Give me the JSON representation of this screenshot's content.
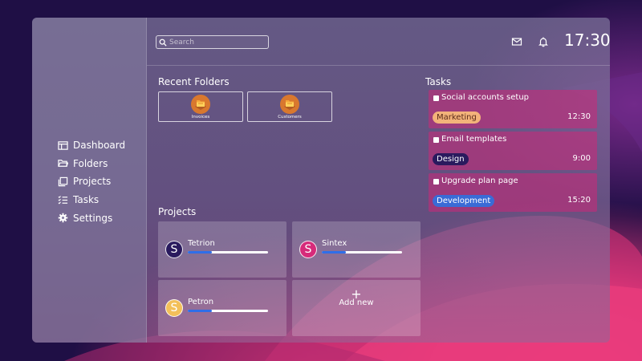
{
  "colors": {
    "accent_blue": "#2f6ee8",
    "tag_marketing": "#f3b37a",
    "tag_design": "#2a1a5e",
    "tag_development": "#3a6bd6",
    "avatar_tetrion": "#2a1a5e",
    "avatar_sintex": "#d62b7a",
    "avatar_petron": "#f3c05a"
  },
  "search": {
    "placeholder": "Search",
    "icon": "search-icon"
  },
  "header": {
    "clock": "17:30",
    "icons": [
      "mail-icon",
      "bell-icon"
    ]
  },
  "sidebar": {
    "items": [
      {
        "label": "Dashboard",
        "icon": "dashboard-icon"
      },
      {
        "label": "Folders",
        "icon": "folder-icon"
      },
      {
        "label": "Projects",
        "icon": "projects-icon"
      },
      {
        "label": "Tasks",
        "icon": "tasks-icon"
      },
      {
        "label": "Settings",
        "icon": "gear-icon"
      }
    ]
  },
  "recent_folders": {
    "title": "Recent Folders",
    "items": [
      {
        "label": "Invoices",
        "icon": "folder-icon"
      },
      {
        "label": "Customers",
        "icon": "folder-icon"
      }
    ]
  },
  "projects": {
    "title": "Projects",
    "items": [
      {
        "initial": "S",
        "name": "Tetrion",
        "progress": 0.3
      },
      {
        "initial": "S",
        "name": "Sintex",
        "progress": 0.3
      },
      {
        "initial": "S",
        "name": "Petron",
        "progress": 0.3
      }
    ],
    "add_new": {
      "plus": "+",
      "label": "Add new"
    }
  },
  "tasks": {
    "title": "Tasks",
    "items": [
      {
        "title": "Social accounts setup",
        "tag": "Marketing",
        "time": "12:30"
      },
      {
        "title": "Email templates",
        "tag": "Design",
        "time": "9:00"
      },
      {
        "title": "Upgrade plan page",
        "tag": "Development",
        "time": "15:20"
      }
    ]
  }
}
